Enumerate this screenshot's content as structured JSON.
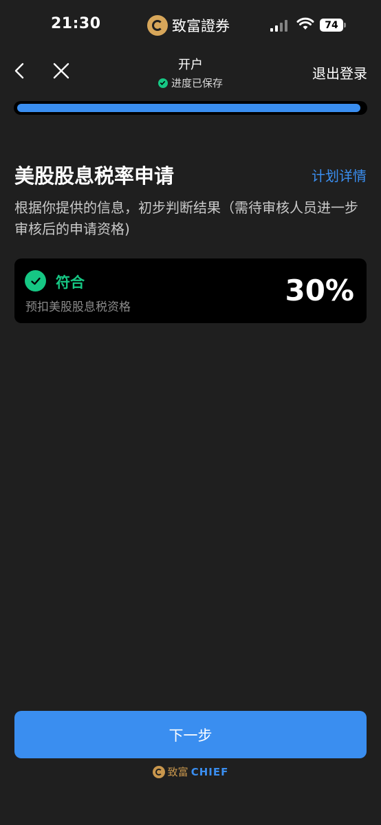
{
  "status_bar": {
    "time": "21:30",
    "brand": "致富證券",
    "battery": "74"
  },
  "nav": {
    "title": "开户",
    "saved_text": "进度已保存",
    "logout_label": "退出登录"
  },
  "progress": {
    "fraction": 0.99
  },
  "main": {
    "title": "美股股息税率申请",
    "plan_link": "计划详情",
    "description": "根据你提供的信息，初步判断结果（需待审核人员进一步审核后的申请资格)"
  },
  "result": {
    "status": "符合",
    "subtitle": "预扣美股股息税资格",
    "rate": "30%"
  },
  "footer": {
    "next_button": "下一步",
    "brand_cn": "致富",
    "brand_en": "CHIEF"
  },
  "colors": {
    "background": "#1f1f1f",
    "accent": "#3a8ef0",
    "success": "#16c784",
    "gold": "#c9974d"
  },
  "icons": [
    "back-icon",
    "close-icon",
    "check-icon",
    "wifi-icon",
    "signal-icon",
    "battery-icon",
    "brand-logo"
  ]
}
